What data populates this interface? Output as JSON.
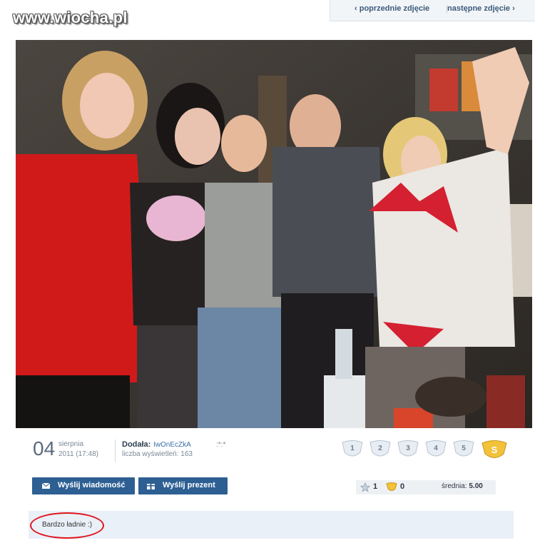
{
  "watermark": "www.wiocha.pl",
  "nav": {
    "prev": "‹ poprzednie zdjęcie",
    "next": "następne zdjęcie ›"
  },
  "photo": {
    "bg_color": "#3a3530"
  },
  "meta": {
    "day": "04",
    "month": "sierpnia",
    "time": "2011 (17:48)",
    "added_label": "Dodała:",
    "added_user": "IwOnEcZkA",
    "views_label": "liczba wyświetleń:",
    "views": "163",
    "emote": ":*:*"
  },
  "ratings": [
    "1",
    "2",
    "3",
    "4",
    "5"
  ],
  "buttons": {
    "message": "Wyślij wiadomość",
    "gift": "Wyślij prezent"
  },
  "stats": {
    "favorites": "1",
    "gold": "0",
    "average_label": "średnia:",
    "average": "5.00"
  },
  "comment": {
    "text": "Bardzo ładnie :)"
  },
  "colors": {
    "accent": "#2d5f93",
    "ring": "#e0141c",
    "comment_bg": "#eaf0f8"
  }
}
